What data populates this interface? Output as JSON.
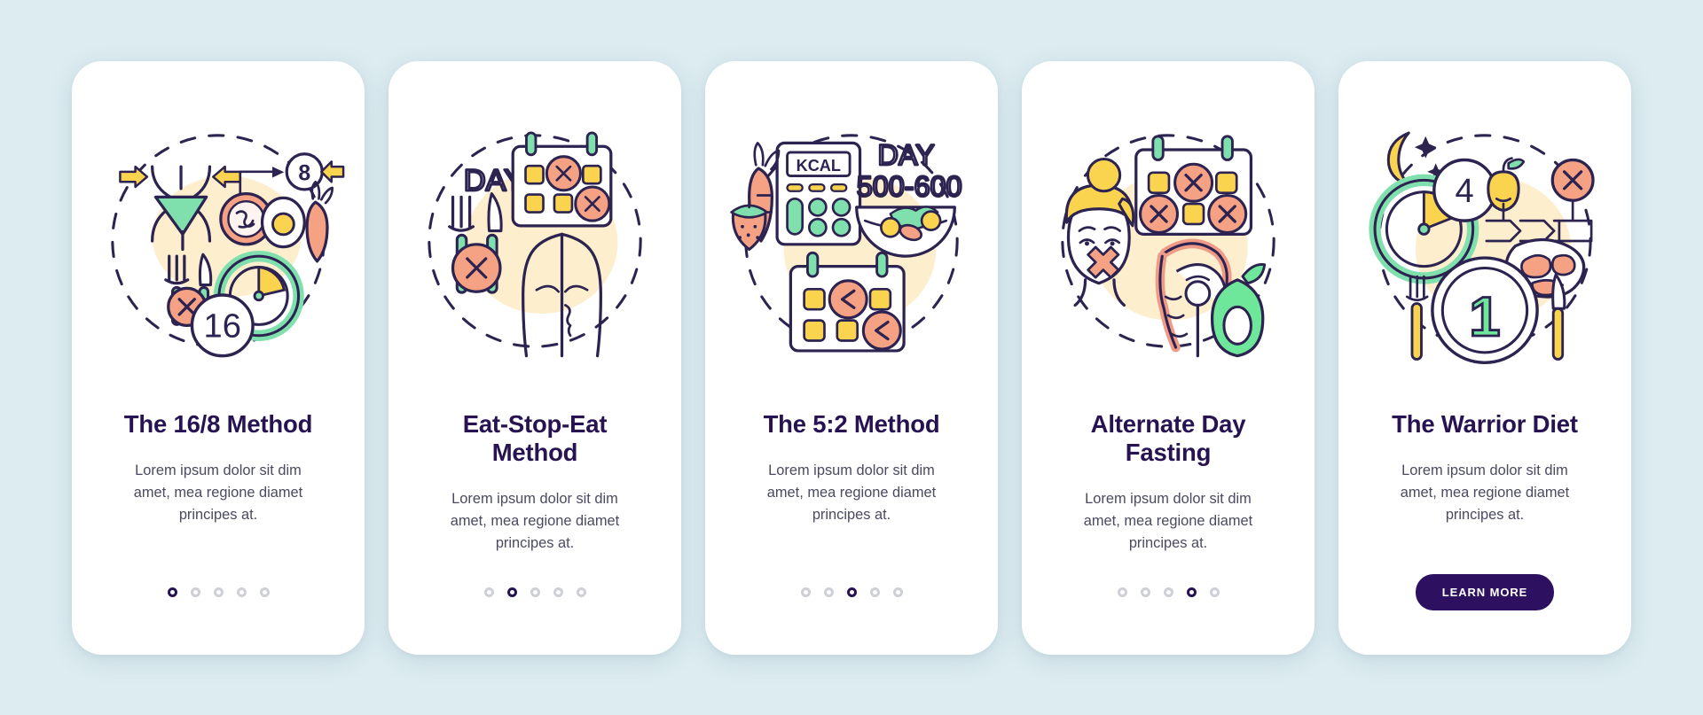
{
  "theme": {
    "page_background": "#dcecf1",
    "card_background": "#ffffff",
    "title_color": "#271351",
    "body_color": "#4b4a60",
    "dot_active_color": "#271351",
    "dot_inactive_color": "#cfcfd8",
    "button_background": "#2d1160",
    "button_text_color": "#ffffff",
    "accent_peach": "#f5a183",
    "accent_green": "#7fe0ae",
    "accent_yellow": "#fbd44f",
    "accent_cream": "#fdeecd",
    "outline_navy": "#2d2350"
  },
  "total_screens": 5,
  "screens": [
    {
      "index": 0,
      "title": "The 16/8 Method",
      "body": "Lorem ipsum dolor sit dim amet, mea regione diamet principes at.",
      "active_dot": 0,
      "footer_type": "dots",
      "illustration": {
        "name": "sixteen-eight-method-illustration",
        "labels": [
          "8",
          "16"
        ],
        "elements": [
          "hourglass",
          "arrows",
          "tomato",
          "egg",
          "carrot",
          "fork",
          "knife",
          "x-badge",
          "clock"
        ]
      }
    },
    {
      "index": 1,
      "title": "Eat-Stop-Eat Method",
      "body": "Lorem ipsum dolor sit dim amet, mea regione diamet principes at.",
      "active_dot": 1,
      "footer_type": "dots",
      "illustration": {
        "name": "eat-stop-eat-illustration",
        "labels": [
          "DAY"
        ],
        "elements": [
          "fork",
          "knife",
          "x-badge",
          "calendar-with-x-marks",
          "torso"
        ]
      }
    },
    {
      "index": 2,
      "title": "The 5:2 Method",
      "body": "Lorem ipsum dolor sit dim amet, mea regione diamet principes at.",
      "active_dot": 2,
      "footer_type": "dots",
      "illustration": {
        "name": "five-two-method-illustration",
        "labels": [
          "KCAL",
          "DAY",
          "500-600"
        ],
        "elements": [
          "calculator",
          "carrot",
          "strawberry",
          "salad-bowl",
          "calendar-with-less-than-marks"
        ]
      }
    },
    {
      "index": 3,
      "title": "Alternate Day Fasting",
      "body": "Lorem ipsum dolor sit dim amet, mea regione diamet principes at.",
      "active_dot": 3,
      "footer_type": "dots",
      "illustration": {
        "name": "alternate-day-fasting-illustration",
        "labels": [],
        "elements": [
          "woman-face-with-x-on-mouth",
          "calendar-with-x-marks",
          "salmon-steak",
          "avocado"
        ]
      }
    },
    {
      "index": 4,
      "title": "The Warrior Diet",
      "body": "Lorem ipsum dolor sit dim amet, mea regione diamet principes at.",
      "active_dot": 4,
      "footer_type": "button",
      "button_label": "LEARN MORE",
      "illustration": {
        "name": "warrior-diet-illustration",
        "labels": [
          "4",
          "1"
        ],
        "elements": [
          "moon",
          "stars",
          "clock",
          "apple",
          "x-badge",
          "steak",
          "plate",
          "fork",
          "knife"
        ]
      }
    }
  ]
}
